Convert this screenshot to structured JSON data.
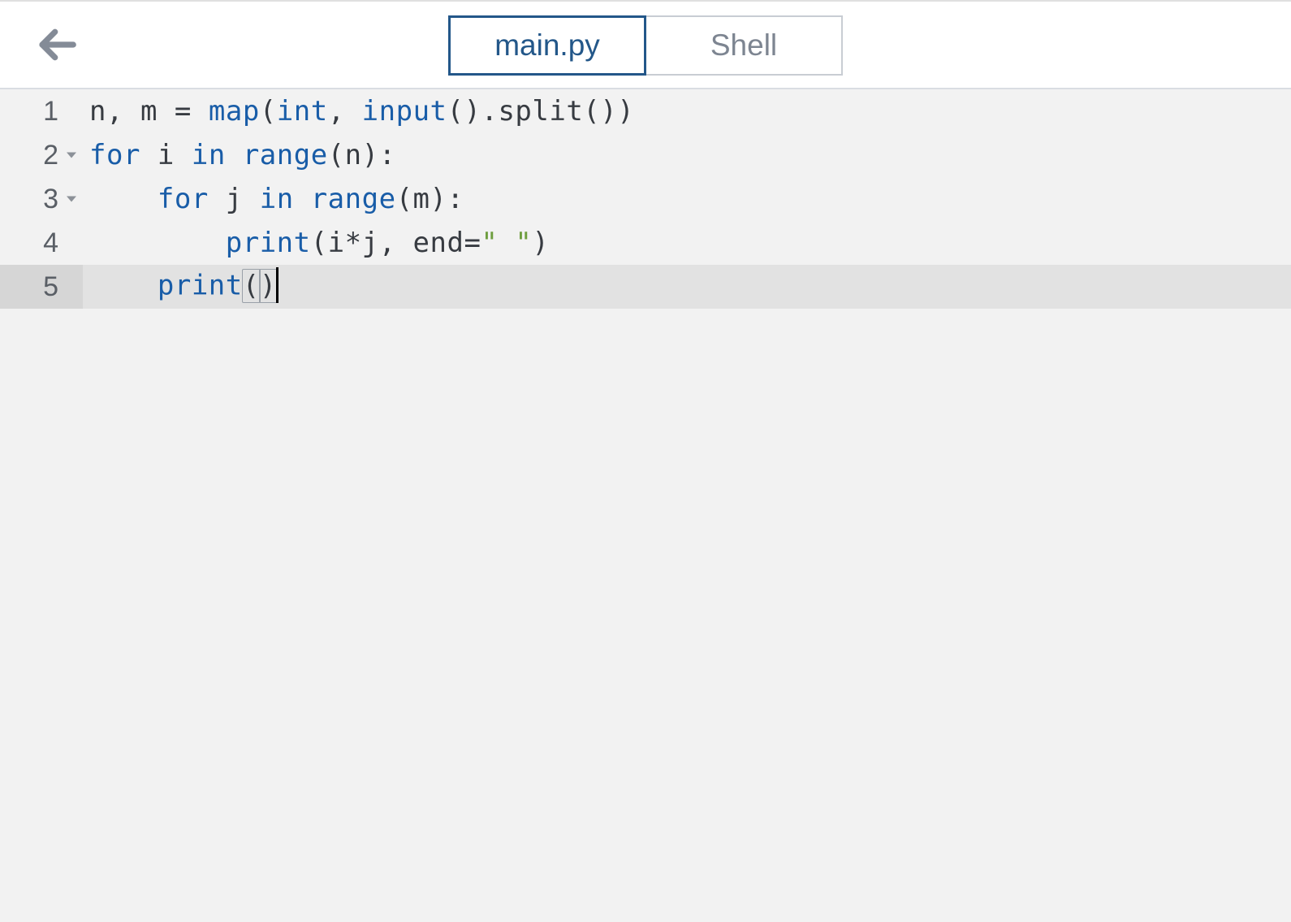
{
  "header": {
    "tabs": [
      {
        "label": "main.py",
        "active": true
      },
      {
        "label": "Shell",
        "active": false
      }
    ]
  },
  "editor": {
    "filename": "main.py",
    "active_line": 5,
    "cursor_line": 5,
    "cursor_col": 12,
    "lines": [
      {
        "num": "1",
        "foldable": false,
        "tokens": [
          {
            "t": "n",
            "c": "tok-id"
          },
          {
            "t": ", ",
            "c": "tok-punc"
          },
          {
            "t": "m",
            "c": "tok-id"
          },
          {
            "t": " ",
            "c": ""
          },
          {
            "t": "=",
            "c": "tok-op"
          },
          {
            "t": " ",
            "c": ""
          },
          {
            "t": "map",
            "c": "tok-builtin"
          },
          {
            "t": "(",
            "c": "tok-punc"
          },
          {
            "t": "int",
            "c": "tok-builtin"
          },
          {
            "t": ", ",
            "c": "tok-punc"
          },
          {
            "t": "input",
            "c": "tok-builtin"
          },
          {
            "t": "().",
            "c": "tok-punc"
          },
          {
            "t": "split",
            "c": "tok-id"
          },
          {
            "t": "())",
            "c": "tok-punc"
          }
        ]
      },
      {
        "num": "2",
        "foldable": true,
        "tokens": [
          {
            "t": "for",
            "c": "tok-kw"
          },
          {
            "t": " ",
            "c": ""
          },
          {
            "t": "i",
            "c": "tok-id"
          },
          {
            "t": " ",
            "c": ""
          },
          {
            "t": "in",
            "c": "tok-kw"
          },
          {
            "t": " ",
            "c": ""
          },
          {
            "t": "range",
            "c": "tok-builtin"
          },
          {
            "t": "(",
            "c": "tok-punc"
          },
          {
            "t": "n",
            "c": "tok-id"
          },
          {
            "t": "):",
            "c": "tok-punc"
          }
        ]
      },
      {
        "num": "3",
        "foldable": true,
        "indent": 1,
        "tokens": [
          {
            "t": "    ",
            "c": ""
          },
          {
            "t": "for",
            "c": "tok-kw"
          },
          {
            "t": " ",
            "c": ""
          },
          {
            "t": "j",
            "c": "tok-id"
          },
          {
            "t": " ",
            "c": ""
          },
          {
            "t": "in",
            "c": "tok-kw"
          },
          {
            "t": " ",
            "c": ""
          },
          {
            "t": "range",
            "c": "tok-builtin"
          },
          {
            "t": "(",
            "c": "tok-punc"
          },
          {
            "t": "m",
            "c": "tok-id"
          },
          {
            "t": "):",
            "c": "tok-punc"
          }
        ]
      },
      {
        "num": "4",
        "foldable": false,
        "indent": 2,
        "guides": [
          1
        ],
        "tokens": [
          {
            "t": "        ",
            "c": ""
          },
          {
            "t": "print",
            "c": "tok-builtin"
          },
          {
            "t": "(",
            "c": "tok-punc"
          },
          {
            "t": "i",
            "c": "tok-id"
          },
          {
            "t": "*",
            "c": "tok-op"
          },
          {
            "t": "j",
            "c": "tok-id"
          },
          {
            "t": ", ",
            "c": "tok-punc"
          },
          {
            "t": "end",
            "c": "tok-id"
          },
          {
            "t": "=",
            "c": "tok-op"
          },
          {
            "t": "\" \"",
            "c": "tok-str"
          },
          {
            "t": ")",
            "c": "tok-punc"
          }
        ]
      },
      {
        "num": "5",
        "foldable": false,
        "indent": 1,
        "active": true,
        "cursor_after": true,
        "tokens": [
          {
            "t": "    ",
            "c": ""
          },
          {
            "t": "print",
            "c": "tok-builtin"
          },
          {
            "t": "(",
            "c": "tok-punc",
            "match": true
          },
          {
            "t": ")",
            "c": "tok-punc",
            "match": true
          }
        ]
      }
    ]
  }
}
